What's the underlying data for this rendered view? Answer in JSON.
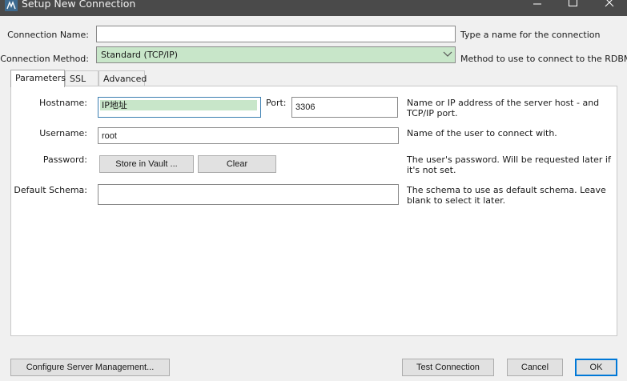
{
  "window": {
    "title": "Setup New Connection"
  },
  "connection_name": {
    "label": "Connection Name:",
    "value": "",
    "hint": "Type a name for the connection"
  },
  "connection_method": {
    "label": "Connection Method:",
    "selected": "Standard (TCP/IP)",
    "hint": "Method to use to connect to the RDBMS"
  },
  "tabs": [
    {
      "label": "Parameters",
      "active": true
    },
    {
      "label": "SSL",
      "active": false
    },
    {
      "label": "Advanced",
      "active": false
    }
  ],
  "parameters": {
    "hostname": {
      "label": "Hostname:",
      "value": "IP地址"
    },
    "port": {
      "label": "Port:",
      "value": "3306"
    },
    "hostname_hint": "Name or IP address of the server host - and TCP/IP port.",
    "username": {
      "label": "Username:",
      "value": "root",
      "hint": "Name of the user to connect with."
    },
    "password": {
      "label": "Password:",
      "store_button": "Store in Vault ...",
      "clear_button": "Clear",
      "hint": "The user's password. Will be requested later if it's not set."
    },
    "default_schema": {
      "label": "Default Schema:",
      "value": "",
      "hint": "The schema to use as default schema. Leave blank to select it later."
    }
  },
  "footer": {
    "configure_button": "Configure Server Management...",
    "test_button": "Test Connection",
    "cancel_button": "Cancel",
    "ok_button": "OK"
  },
  "colors": {
    "titlebar": "#4a4a4a",
    "select_highlight": "#c8e6c9",
    "focus_border": "#3c7fb1",
    "default_button_border": "#0078d7"
  }
}
